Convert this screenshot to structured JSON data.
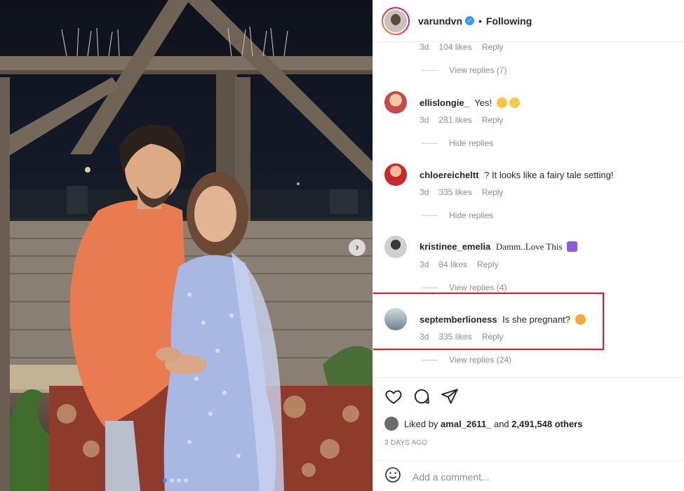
{
  "post": {
    "username": "varundvn",
    "follow_status": "Following",
    "bullet": "•",
    "verified_icon": "verified-badge-icon",
    "next_icon": "chevron-right-icon",
    "carousel_count": 4
  },
  "comments": [
    {
      "user": "",
      "text": "",
      "age": "3d",
      "likes": "104 likes",
      "reply": "Reply",
      "replies_toggle": "View replies (7)"
    },
    {
      "user": "ellislongie_",
      "text": "Yes!",
      "emojis": [
        "crying-face",
        "grin-sweat"
      ],
      "age": "3d",
      "likes": "281 likes",
      "reply": "Reply",
      "replies_toggle": "Hide replies"
    },
    {
      "user": "chloereicheltt",
      "text": "? It looks like a fairy tale setting!",
      "age": "3d",
      "likes": "335 likes",
      "reply": "Reply",
      "replies_toggle": "Hide replies"
    },
    {
      "user": "kristinee_emelia",
      "text": "Damm..Love This",
      "emojis": [
        "purple-heart"
      ],
      "age": "3d",
      "likes": "84 likes",
      "reply": "Reply",
      "replies_toggle": "View replies (4)"
    },
    {
      "user": "septemberlioness",
      "text": "Is she pregnant?",
      "emojis": [
        "star-struck"
      ],
      "age": "3d",
      "likes": "335 likes",
      "reply": "Reply",
      "replies_toggle": "View replies (24)",
      "highlighted": true
    }
  ],
  "footer": {
    "liked_by_prefix": "Liked by",
    "liked_by_user": "amal_2611_",
    "liked_by_and": "and",
    "liked_by_count": "2,491,548 others",
    "posted_time": "3 DAYS AGO",
    "comment_placeholder": "Add a comment..."
  },
  "colors": {
    "link_blue": "#3897f0",
    "highlight_red": "#d71920",
    "muted_gray": "#8e8e8e"
  }
}
